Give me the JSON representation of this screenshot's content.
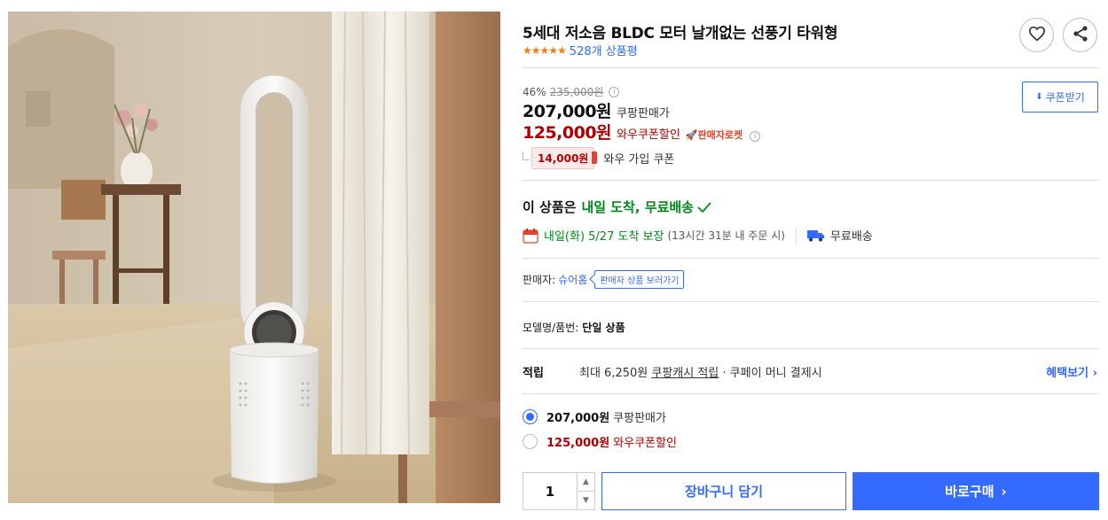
{
  "product": {
    "title": "5세대 저소음 BLDC 모터 날개없는 선풍기 타워형",
    "stars": "★★★★★",
    "review_count": "528개 상품평",
    "rating_value": 5
  },
  "pricing": {
    "discount_rate": "46%",
    "original_price": "235,000원",
    "sale_price": "207,000원",
    "sale_label": "쿠팡판매가",
    "coupon_price": "125,000원",
    "coupon_label": "와우쿠폰할인",
    "rocket_badge": "🚀판매자로켓",
    "wow_amount": "14,000원",
    "wow_label": "와우 가입 쿠폰",
    "coupon_button": "쿠폰받기"
  },
  "delivery": {
    "headline_prefix": "이 상품은",
    "headline_green": "내일 도착, 무료배송",
    "arrival": "내일(화) 5/27 도착 보장",
    "arrival_note": "(13시간 31분 내 주문 시)",
    "shipping": "무료배송"
  },
  "seller": {
    "label": "판매자:",
    "name": "슈어홈",
    "tooltip": "판매자 상품 보러가기"
  },
  "model": {
    "label": "모델명/품번:",
    "value": "단일 상품"
  },
  "reward": {
    "label": "적립",
    "text_prefix": "최대 6,250원",
    "text_link": "쿠팡캐시 적립",
    "text_suffix": "· 쿠페이 머니 결제시",
    "benefit_link": "혜택보기 ›"
  },
  "options": [
    {
      "price": "207,000원",
      "label": "쿠팡판매가",
      "selected": true
    },
    {
      "price": "125,000원",
      "label": "와우쿠폰할인",
      "selected": false
    }
  ],
  "purchase": {
    "quantity": "1",
    "cart_button": "장바구니 담기",
    "buy_button": "바로구매",
    "buy_chevron": "›"
  },
  "colors": {
    "accent": "#346aff",
    "coupon_red": "#ae0000",
    "delivery_green": "#00891a",
    "star_orange": "#f57c0f"
  }
}
